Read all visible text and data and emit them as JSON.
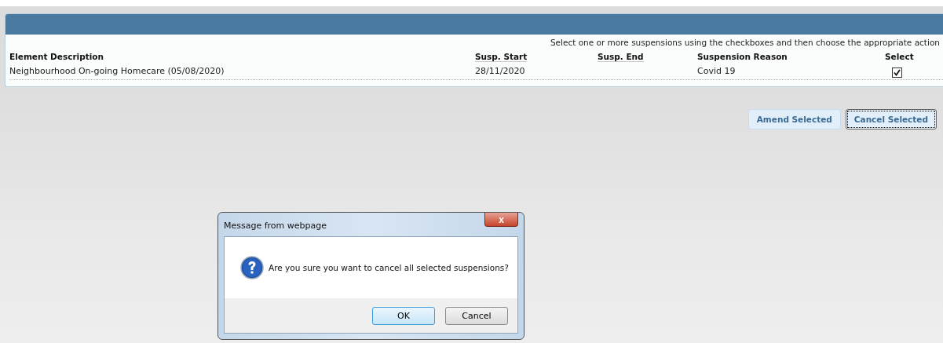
{
  "panel": {
    "instruction": "Select one or more suspensions using the checkboxes and then choose the appropriate action",
    "columns": [
      {
        "label": "Element Description",
        "sortable": false
      },
      {
        "label": "Susp. Start",
        "sortable": true
      },
      {
        "label": "Susp. End",
        "sortable": true
      },
      {
        "label": "Suspension Reason",
        "sortable": false
      },
      {
        "label": "Select",
        "sortable": false
      }
    ],
    "rows": [
      {
        "description": "Neighbourhood On-going Homecare (05/08/2020)",
        "start": "28/11/2020",
        "end": "",
        "reason": "Covid 19",
        "checked": true
      }
    ]
  },
  "actions": [
    {
      "label": "Amend Selected",
      "focused": false
    },
    {
      "label": "Cancel Selected",
      "focused": true
    }
  ],
  "dialog": {
    "title": "Message from webpage",
    "close": "x",
    "message": "Are you sure you want to cancel all selected suspensions?",
    "buttons": [
      {
        "label": "OK",
        "focused": true
      },
      {
        "label": "Cancel",
        "focused": false
      }
    ]
  }
}
